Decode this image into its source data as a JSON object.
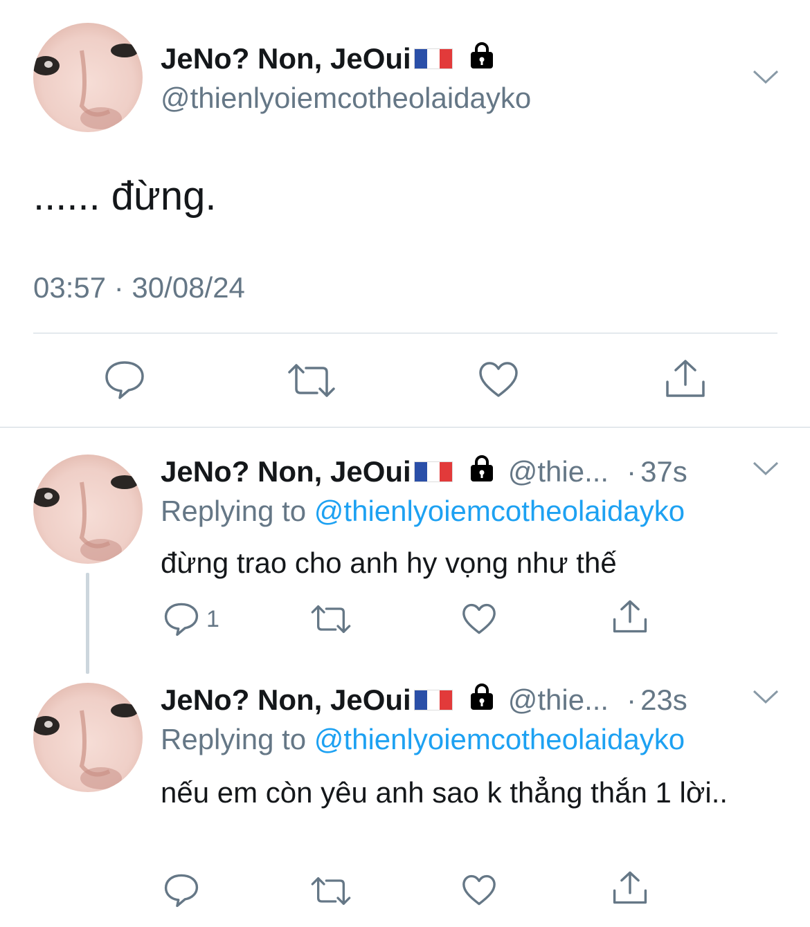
{
  "main_tweet": {
    "display_name": "JeNo? Non, JeOui",
    "handle": "@thienlyoiemcotheolaidayko",
    "text": "...... đừng.",
    "timestamp": "03:57 · 30/08/24",
    "actions": [
      "reply-icon",
      "retweet-icon",
      "like-icon",
      "share-icon"
    ]
  },
  "replies": [
    {
      "display_name": "JeNo? Non, JeOui",
      "handle_truncated": "@thie...",
      "age": "37s",
      "replying_prefix": "Replying to",
      "replying_handle": "@thienlyoiemcotheolaidayko",
      "text": "đừng trao cho anh hy vọng như thế",
      "reply_count": "1"
    },
    {
      "display_name": "JeNo? Non, JeOui",
      "handle_truncated": "@thie...",
      "age": "23s",
      "replying_prefix": "Replying to",
      "replying_handle": "@thienlyoiemcotheolaidayko",
      "text": "nếu em còn yêu anh sao k thẳng thắn 1 lời..",
      "reply_count": ""
    }
  ],
  "colors": {
    "text": "#14171a",
    "secondary": "#657786",
    "link": "#1da1f2",
    "divider": "#ccd6dd"
  }
}
